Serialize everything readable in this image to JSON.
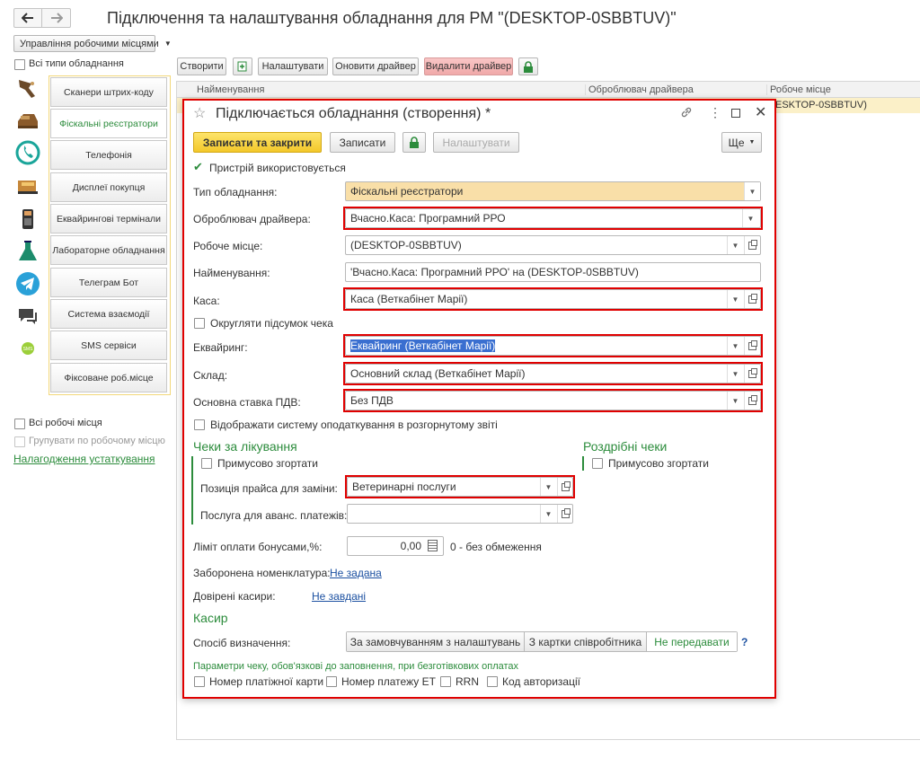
{
  "window": {
    "title": "Підключення та налаштування обладнання для РМ \"(DESKTOP-0SBBTUV)\"",
    "back_icon": "arrow-left-icon",
    "forward_icon": "arrow-right-icon"
  },
  "left": {
    "manage_label": "Управління робочими місцями",
    "all_types_label": "Всі типи обладнання",
    "nav": [
      {
        "label": "Сканери штрих-коду",
        "icon": "barcode-scanner-icon"
      },
      {
        "label": "Фіскальні реєстратори",
        "icon": "cash-register-icon"
      },
      {
        "label": "Телефонія",
        "icon": "phone-icon"
      },
      {
        "label": "Дисплеї покупця",
        "icon": "customer-display-icon"
      },
      {
        "label": "Еквайрингові термінали",
        "icon": "pos-terminal-icon"
      },
      {
        "label": "Лабораторне обладнання",
        "icon": "lab-flask-icon"
      },
      {
        "label": "Телеграм Бот",
        "icon": "telegram-icon"
      },
      {
        "label": "Система взаємодії",
        "icon": "chat-icon"
      },
      {
        "label": "SMS сервіси",
        "icon": "sms-icon"
      },
      {
        "label": "Фіксоване роб.місце",
        "icon": ""
      }
    ],
    "active_index": 1,
    "all_workplaces_label": "Всі робочі місця",
    "group_by_label": "Групувати по робочому місцю",
    "setup_link": "Налагодження устаткування"
  },
  "toolbar": {
    "create": "Створити",
    "settings": "Налаштувати",
    "update_driver": "Оновити драйвер",
    "delete_driver": "Видалити драйвер"
  },
  "table": {
    "columns": [
      "Найменування",
      "Оброблювач драйвера",
      "Робоче місце"
    ],
    "row_workplace": "ESKTOP-0SBBTUV)"
  },
  "dialog": {
    "title": "Підключається обладнання (створення) *",
    "save_close": "Записати та закрити",
    "save": "Записати",
    "setup": "Налаштувати",
    "more": "Ще",
    "device_used": "Пристрій використовується",
    "fields": {
      "type_label": "Тип обладнання:",
      "type_value": "Фіскальні реєстратори",
      "driver_label": "Оброблювач драйвера:",
      "driver_value": "Вчасно.Каса: Програмний РРО",
      "workplace_label": "Робоче місце:",
      "workplace_value": "(DESKTOP-0SBBTUV)",
      "name_label": "Найменування:",
      "name_value": "'Вчасно.Каса: Програмний РРО' на (DESKTOP-0SBBTUV)",
      "kasa_label": "Каса:",
      "kasa_value": "Каса (Веткабінет Марії)",
      "round_label": "Округляти підсумок чека",
      "acq_label": "Еквайринг:",
      "acq_value": "Еквайринг (Веткабінет Марії)",
      "store_label": "Склад:",
      "store_value": "Основний склад (Веткабінет Марії)",
      "vat_label": "Основна ставка ПДВ:",
      "vat_value": "Без ПДВ",
      "tax_report_label": "Відображати систему оподаткування в розгорнутому звіті"
    },
    "medical": {
      "heading": "Чеки за лікування",
      "force_collapse": "Примусово згортати",
      "price_pos_label": "Позиція прайса для заміни:",
      "price_pos_value": "Ветеринарні послуги",
      "advance_label": "Послуга для аванс. платежів:",
      "advance_value": ""
    },
    "retail": {
      "heading": "Роздрібні чеки",
      "force_collapse": "Примусово згортати"
    },
    "bonus_label": "Ліміт оплати бонусами,%:",
    "bonus_value": "0,00",
    "bonus_hint": "0 - без обмеження",
    "forbidden_label": "Заборонена номенклатура:",
    "forbidden_link": "Не задана",
    "cashiers_label": "Довірені касири:",
    "cashiers_link": "Не завдані",
    "cashier": {
      "heading": "Касир",
      "method_label": "Спосіб визначення:",
      "options": [
        "За замовчуванням з налаштувань",
        "З картки співробітника",
        "Не передавати"
      ],
      "selected_index": 2,
      "help": "?"
    },
    "params_heading": "Параметри чеку, обов'язкові до заповнення, при безготівкових оплатах",
    "params": [
      "Номер платіжної карти",
      "Номер платежу ЕТ",
      "RRN",
      "Код авторизації"
    ]
  },
  "colors": {
    "accent_green": "#2c8c3c",
    "highlight_red": "#e00000",
    "primary_yellow": "#f6d23b",
    "type_field_bg": "#f9dfa8"
  }
}
